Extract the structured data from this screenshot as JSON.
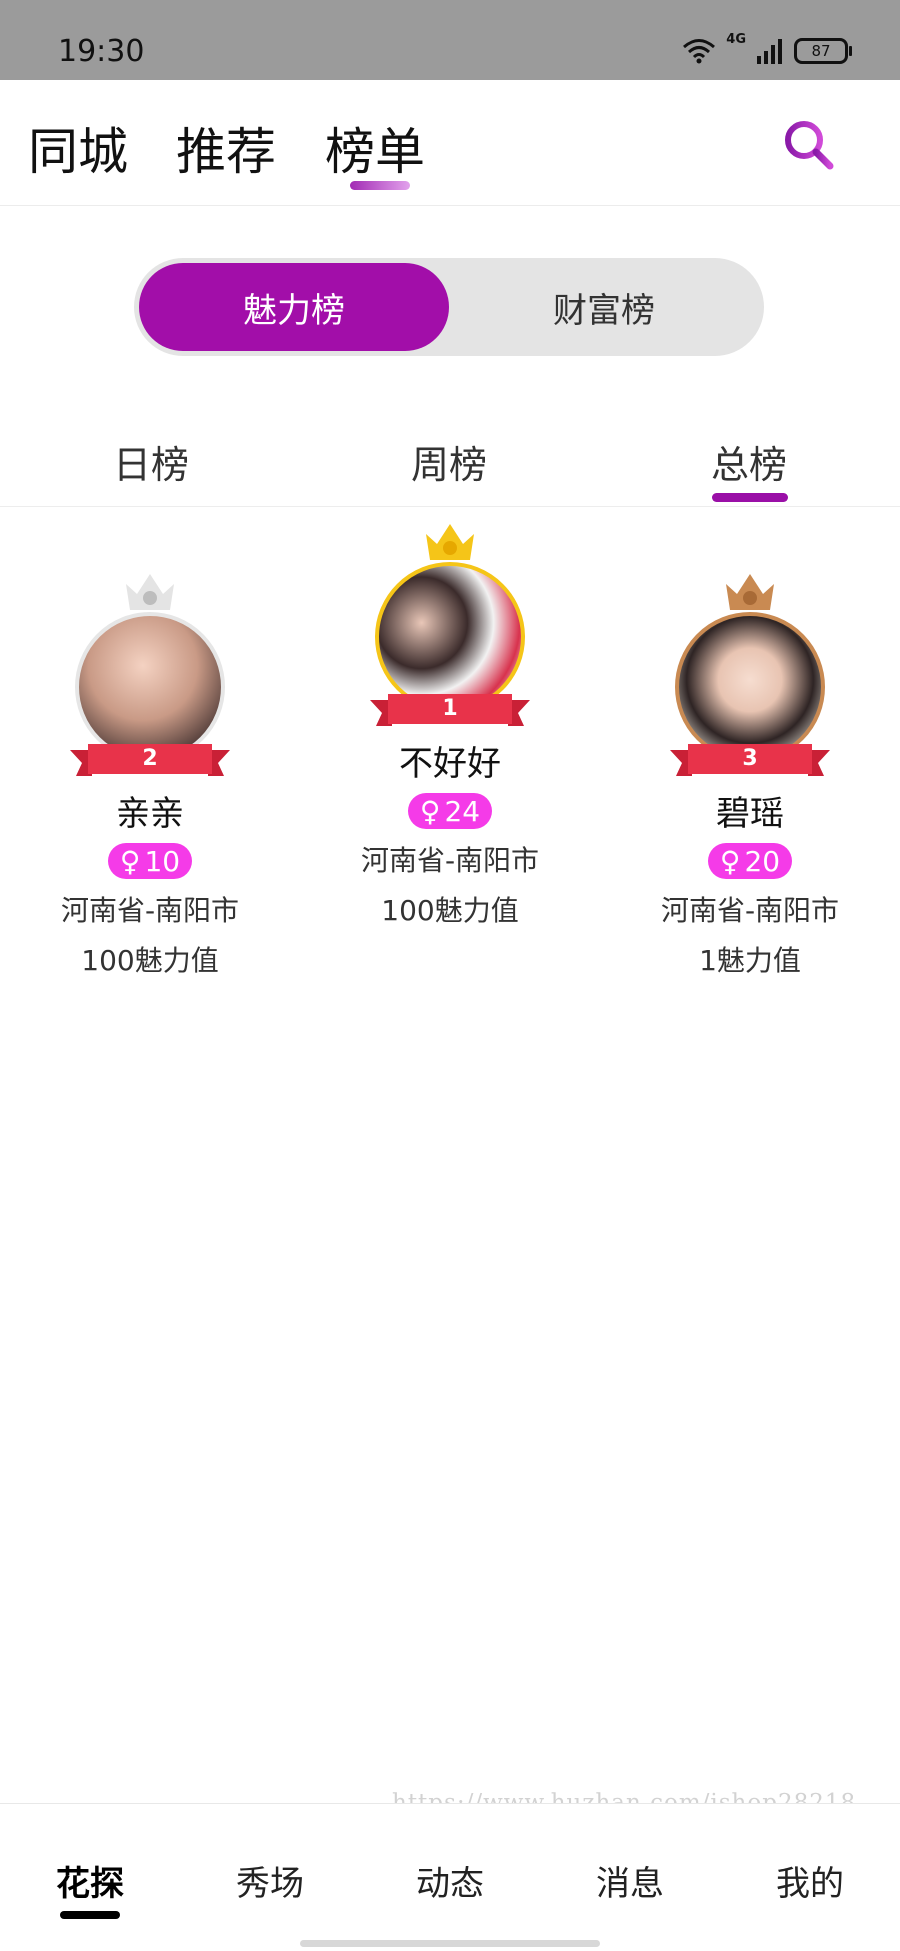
{
  "status": {
    "time": "19:30",
    "network": "4G",
    "battery": "87"
  },
  "top_tabs": [
    {
      "label": "同城",
      "active": false
    },
    {
      "label": "推荐",
      "active": false
    },
    {
      "label": "榜单",
      "active": true
    }
  ],
  "segment": {
    "active": "魅力榜",
    "inactive": "财富榜"
  },
  "period_tabs": [
    {
      "label": "日榜",
      "active": false
    },
    {
      "label": "周榜",
      "active": false
    },
    {
      "label": "总榜",
      "active": true
    }
  ],
  "ranking": [
    {
      "rank": "2",
      "name": "亲亲",
      "gender_icon": "♀",
      "age": "10",
      "location": "河南省-南阳市",
      "value": "100魅力值"
    },
    {
      "rank": "1",
      "name": "不好好",
      "gender_icon": "♀",
      "age": "24",
      "location": "河南省-南阳市",
      "value": "100魅力值"
    },
    {
      "rank": "3",
      "name": "碧瑶",
      "gender_icon": "♀",
      "age": "20",
      "location": "河南省-南阳市",
      "value": "1魅力值"
    }
  ],
  "watermark": "https://www.huzhan.com/ishop28218",
  "bottom_nav": [
    {
      "label": "花探",
      "active": true
    },
    {
      "label": "秀场",
      "active": false
    },
    {
      "label": "动态",
      "active": false
    },
    {
      "label": "消息",
      "active": false
    },
    {
      "label": "我的",
      "active": false
    }
  ],
  "colors": {
    "accent": "#a20ea9",
    "badge": "#f53be8",
    "ribbon": "#e8334a",
    "gold": "#f5c518",
    "silver": "#d9d9d9",
    "bronze": "#c98a52"
  },
  "icons": {
    "search": "search-icon",
    "gender": "female-icon",
    "crown": "crown-icon"
  }
}
